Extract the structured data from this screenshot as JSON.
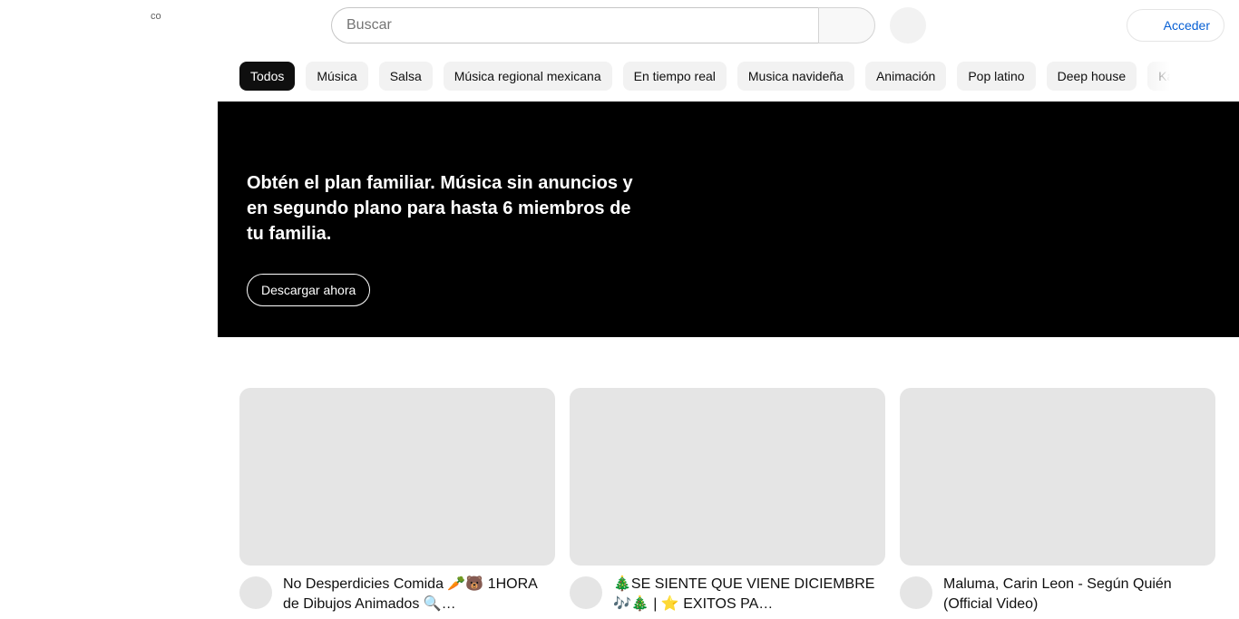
{
  "header": {
    "logo_text": "co",
    "search_placeholder": "Buscar",
    "signin_label": "Acceder"
  },
  "chips": [
    {
      "label": "Todos",
      "active": true
    },
    {
      "label": "Música",
      "active": false
    },
    {
      "label": "Salsa",
      "active": false
    },
    {
      "label": "Música regional mexicana",
      "active": false
    },
    {
      "label": "En tiempo real",
      "active": false
    },
    {
      "label": "Musica navideña",
      "active": false
    },
    {
      "label": "Animación",
      "active": false
    },
    {
      "label": "Pop latino",
      "active": false
    },
    {
      "label": "Deep house",
      "active": false
    },
    {
      "label": "Ka",
      "active": false
    }
  ],
  "banner": {
    "title": "Obtén el plan familiar. Música sin anuncios y en segundo plano para hasta 6 miembros de tu familia.",
    "button_label": "Descargar ahora"
  },
  "videos": [
    {
      "title": "No Desperdicies Comida 🥕🐻 1HORA de Dibujos Animados 🔍…"
    },
    {
      "title": "🎄SE SIENTE QUE VIENE DICIEMBRE 🎶🎄 | ⭐ EXITOS PA…"
    },
    {
      "title": "Maluma, Carin Leon - Según Quién (Official Video)"
    }
  ],
  "colors": {
    "accent_link": "#065fd4",
    "chip_active_bg": "#0f0f0f",
    "chip_bg": "#f2f2f2",
    "banner_bg": "#000000",
    "placeholder_gray": "#e5e5e5"
  }
}
